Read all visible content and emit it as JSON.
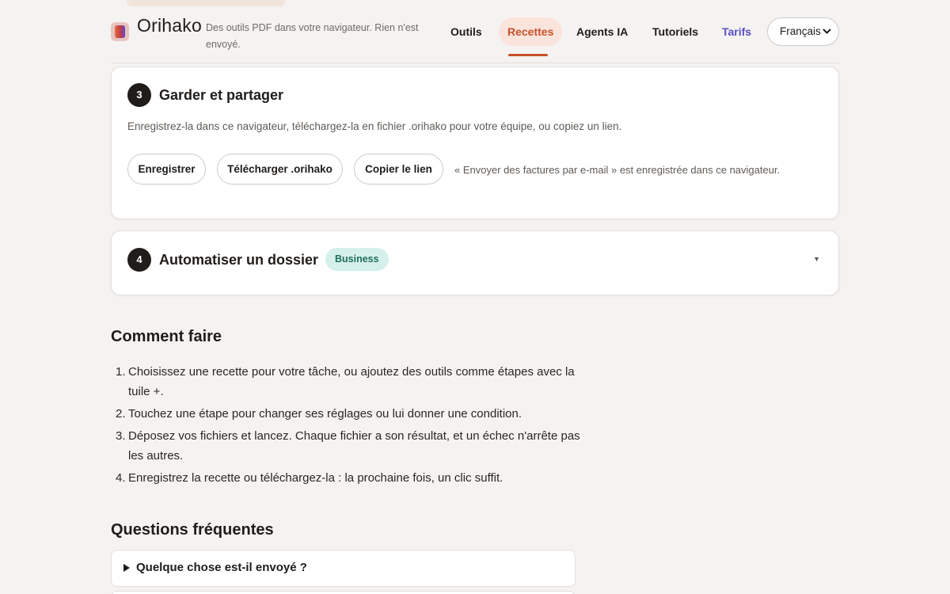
{
  "header": {
    "brand": "Orihako",
    "tagline": "Des outils PDF dans votre navigateur. Rien n'est envoyé.",
    "nav": {
      "outils": "Outils",
      "recettes": "Recettes",
      "agents": "Agents IA",
      "tutoriels": "Tutoriels",
      "tarifs": "Tarifs"
    },
    "language": "Français",
    "active_nav": "recettes"
  },
  "steps": {
    "save": {
      "number": "3",
      "title": "Garder et partager",
      "description": "Enregistrez-la dans ce navigateur, téléchargez-la en fichier .orihako pour votre équipe, ou copiez un lien.",
      "save_label": "Enregistrer",
      "download_label": "Télécharger .orihako",
      "copy_label": "Copier le lien",
      "status": "« Envoyer des factures par e-mail » est enregistrée dans ce navigateur."
    },
    "automate": {
      "number": "4",
      "title": "Automatiser un dossier",
      "badge": "Business",
      "expanded": false
    }
  },
  "howto": {
    "title": "Comment faire",
    "items": [
      {
        "num": "1.",
        "text": "Choisissez une recette pour votre tâche, ou ajoutez des outils comme étapes avec la tuile +."
      },
      {
        "num": "2.",
        "text": "Touchez une étape pour changer ses réglages ou lui donner une condition."
      },
      {
        "num": "3.",
        "text": "Déposez vos fichiers et lancez. Chaque fichier a son résultat, et un échec n'arrête pas les autres."
      },
      {
        "num": "4.",
        "text": "Enregistrez la recette ou téléchargez-la : la prochaine fois, un clic suffit."
      }
    ]
  },
  "faq": {
    "title": "Questions fréquentes",
    "items": [
      {
        "question": "Quelque chose est-il envoyé ?",
        "expanded": false
      }
    ]
  },
  "colors": {
    "accent": "#c8502b",
    "accent_bg": "#fbe4dc",
    "tarifs": "#5a4ec4",
    "business_bg": "#d5f0ea",
    "business_text": "#1f6e5e",
    "page_bg": "#f5f3f1"
  },
  "icons": {
    "logo": "orihako-logo-icon",
    "select_caret": "chevron-down-icon",
    "expand_caret": "caret-down-icon",
    "faq_toggle": "triangle-right-icon"
  }
}
